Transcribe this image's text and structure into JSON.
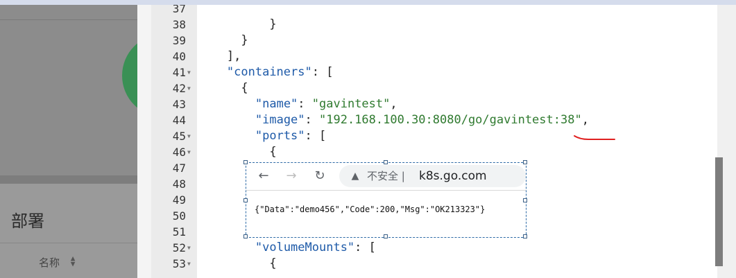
{
  "background_page": {
    "section_title": "部署",
    "column_header": "名称"
  },
  "editor": {
    "lines": [
      {
        "num": "37",
        "fold": false,
        "indent": 0,
        "segs": []
      },
      {
        "num": "38",
        "fold": false,
        "indent": 7,
        "segs": [
          {
            "t": "p",
            "v": "}"
          }
        ]
      },
      {
        "num": "39",
        "fold": false,
        "indent": 5,
        "segs": [
          {
            "t": "p",
            "v": "}"
          }
        ]
      },
      {
        "num": "40",
        "fold": false,
        "indent": 4,
        "segs": [
          {
            "t": "p",
            "v": "],"
          }
        ]
      },
      {
        "num": "41",
        "fold": true,
        "indent": 4,
        "segs": [
          {
            "t": "k",
            "v": "\"containers\""
          },
          {
            "t": "p",
            "v": ": ["
          }
        ]
      },
      {
        "num": "42",
        "fold": true,
        "indent": 5,
        "segs": [
          {
            "t": "p",
            "v": "{"
          }
        ]
      },
      {
        "num": "43",
        "fold": false,
        "indent": 6,
        "segs": [
          {
            "t": "k",
            "v": "\"name\""
          },
          {
            "t": "p",
            "v": ": "
          },
          {
            "t": "s",
            "v": "\"gavintest\""
          },
          {
            "t": "p",
            "v": ","
          }
        ]
      },
      {
        "num": "44",
        "fold": false,
        "indent": 6,
        "segs": [
          {
            "t": "k",
            "v": "\"image\""
          },
          {
            "t": "p",
            "v": ": "
          },
          {
            "t": "s",
            "v": "\"192.168.100.30:8080/go/gavintest:38\""
          },
          {
            "t": "p",
            "v": ","
          }
        ]
      },
      {
        "num": "45",
        "fold": true,
        "indent": 6,
        "segs": [
          {
            "t": "k",
            "v": "\"ports\""
          },
          {
            "t": "p",
            "v": ": ["
          }
        ]
      },
      {
        "num": "46",
        "fold": true,
        "indent": 7,
        "segs": [
          {
            "t": "p",
            "v": "{"
          }
        ]
      },
      {
        "num": "47",
        "fold": false,
        "indent": 0,
        "segs": []
      },
      {
        "num": "48",
        "fold": false,
        "indent": 0,
        "segs": []
      },
      {
        "num": "49",
        "fold": false,
        "indent": 0,
        "segs": []
      },
      {
        "num": "50",
        "fold": false,
        "indent": 0,
        "segs": []
      },
      {
        "num": "51",
        "fold": false,
        "indent": 0,
        "segs": []
      },
      {
        "num": "52",
        "fold": true,
        "indent": 6,
        "segs": [
          {
            "t": "k",
            "v": "\"volumeMounts\""
          },
          {
            "t": "p",
            "v": ": ["
          }
        ]
      },
      {
        "num": "53",
        "fold": true,
        "indent": 7,
        "segs": [
          {
            "t": "p",
            "v": "{"
          }
        ]
      }
    ]
  },
  "snippet": {
    "security_text": "不安全 |",
    "url": "k8s.go.com",
    "response_text": "{\"Data\":\"demo456\",\"Code\":200,\"Msg\":\"OK213323\"}"
  },
  "icons": {
    "back": "arrow-left-icon",
    "forward": "arrow-right-icon",
    "reload": "reload-icon",
    "warning": "warning-icon",
    "fold": "fold-arrow-icon",
    "sort": "sort-icon"
  },
  "colors": {
    "json_key": "#1e5aa8",
    "json_string": "#2f7a2f",
    "annotation": "#e02020",
    "gutter": "#ebebeb",
    "overlay": "#8c8c8c",
    "accent_circle": "#3a9055"
  }
}
